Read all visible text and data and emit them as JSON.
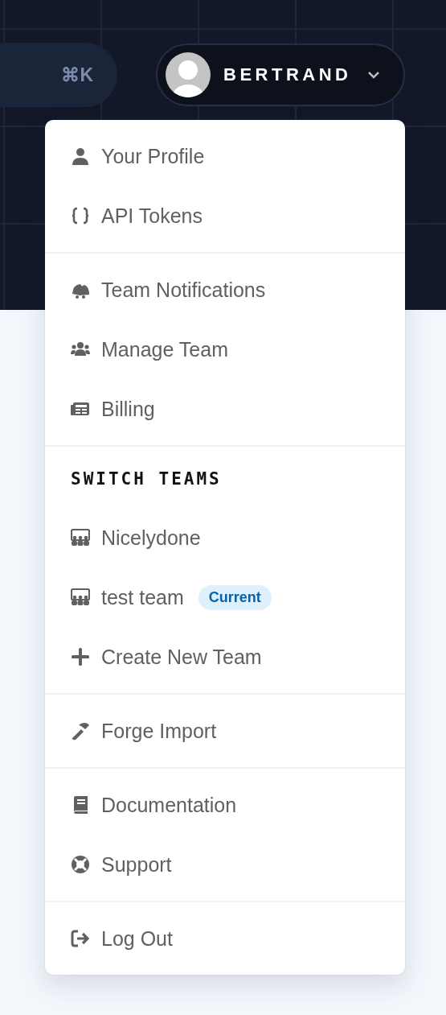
{
  "header": {
    "search_shortcut": "⌘K",
    "user": {
      "name": "BERTRAND",
      "expanded": true
    }
  },
  "menu": {
    "sections": [
      {
        "items": [
          {
            "label": "Your Profile"
          },
          {
            "label": "API Tokens"
          }
        ]
      },
      {
        "items": [
          {
            "label": "Team Notifications"
          },
          {
            "label": "Manage Team"
          },
          {
            "label": "Billing"
          }
        ]
      },
      {
        "heading": "SWITCH TEAMS",
        "items": [
          {
            "label": "Nicelydone"
          },
          {
            "label": "test team",
            "badge": "Current"
          },
          {
            "label": "Create New Team"
          }
        ]
      },
      {
        "items": [
          {
            "label": "Forge Import"
          }
        ]
      },
      {
        "items": [
          {
            "label": "Documentation"
          },
          {
            "label": "Support"
          }
        ]
      },
      {
        "items": [
          {
            "label": "Log Out"
          }
        ]
      }
    ]
  }
}
